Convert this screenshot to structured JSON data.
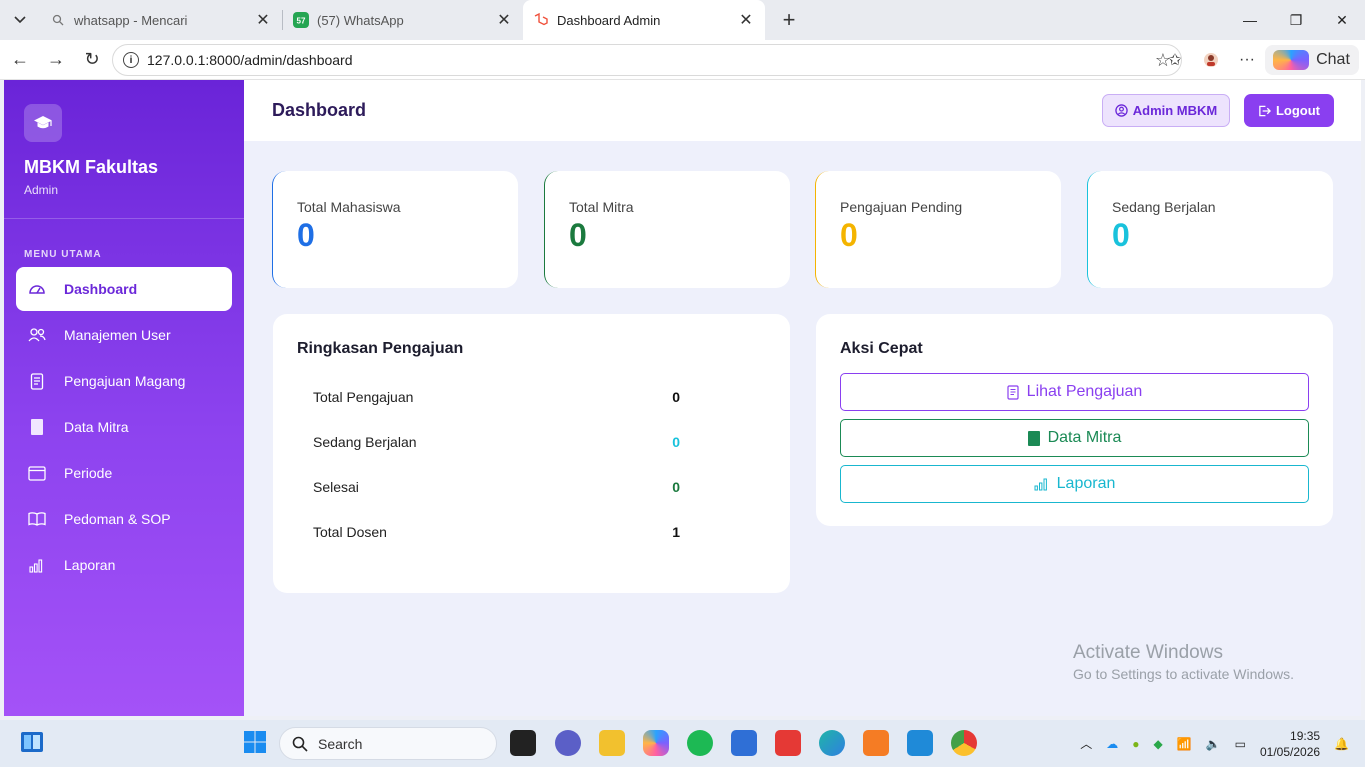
{
  "browser": {
    "tabs": [
      {
        "title": "whatsapp - Mencari",
        "active": false
      },
      {
        "title": "(57) WhatsApp",
        "active": false
      },
      {
        "title": "Dashboard Admin",
        "active": true
      }
    ],
    "url": "127.0.0.1:8000/admin/dashboard",
    "chat_label": "Chat"
  },
  "sidebar": {
    "brand": "MBKM Fakultas",
    "role": "Admin",
    "menu_heading": "MENU UTAMA",
    "items": [
      {
        "label": "Dashboard",
        "icon": "gauge-icon",
        "active": true
      },
      {
        "label": "Manajemen User",
        "icon": "users-icon"
      },
      {
        "label": "Pengajuan Magang",
        "icon": "document-icon"
      },
      {
        "label": "Data Mitra",
        "icon": "book-icon"
      },
      {
        "label": "Periode",
        "icon": "calendar-icon"
      },
      {
        "label": "Pedoman & SOP",
        "icon": "open-book-icon"
      },
      {
        "label": "Laporan",
        "icon": "bar-chart-icon"
      }
    ]
  },
  "header": {
    "title": "Dashboard",
    "admin_label": "Admin MBKM",
    "logout_label": "Logout"
  },
  "stats": [
    {
      "label": "Total Mahasiswa",
      "value": "0",
      "color": "#1f6fe5"
    },
    {
      "label": "Total Mitra",
      "value": "0",
      "color": "#1b7a3e"
    },
    {
      "label": "Pengajuan Pending",
      "value": "0",
      "color": "#f4b400"
    },
    {
      "label": "Sedang Berjalan",
      "value": "0",
      "color": "#19c2dc"
    }
  ],
  "summary": {
    "title": "Ringkasan Pengajuan",
    "rows": [
      {
        "label": "Total Pengajuan",
        "value": "0",
        "color": "#111111"
      },
      {
        "label": "Sedang Berjalan",
        "value": "0",
        "color": "#19c2dc"
      },
      {
        "label": "Selesai",
        "value": "0",
        "color": "#1b7a3e"
      },
      {
        "label": "Total Dosen",
        "value": "1",
        "color": "#111111"
      }
    ]
  },
  "quick_actions": {
    "title": "Aksi Cepat",
    "buttons": [
      {
        "label": "Lihat Pengajuan",
        "color": "#8a3ff0"
      },
      {
        "label": "Data Mitra",
        "color": "#1b8a55"
      },
      {
        "label": "Laporan",
        "color": "#19b7cf"
      }
    ]
  },
  "watermark": {
    "line1": "Activate Windows",
    "line2": "Go to Settings to activate Windows."
  },
  "taskbar": {
    "search_placeholder": "Search",
    "time": "19:35",
    "date": "01/05/2026"
  }
}
